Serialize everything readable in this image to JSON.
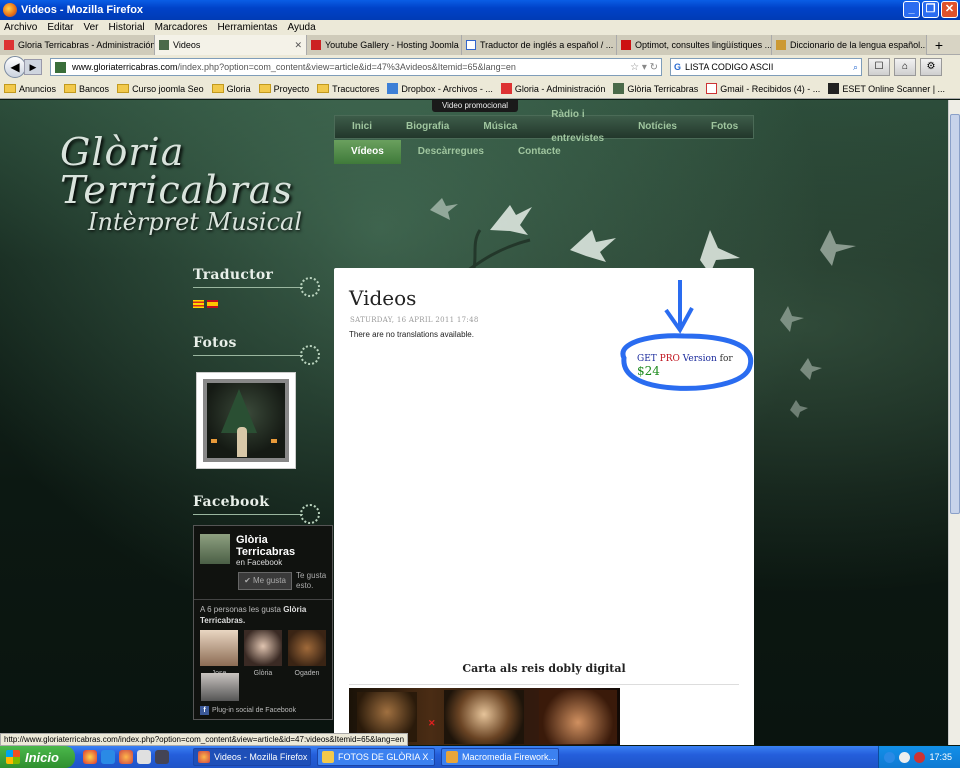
{
  "window": {
    "title": "Videos - Mozilla Firefox",
    "controls": [
      "_",
      "❐",
      "✕"
    ]
  },
  "menubar": [
    "Archivo",
    "Editar",
    "Ver",
    "Historial",
    "Marcadores",
    "Herramientas",
    "Ayuda"
  ],
  "tabs": [
    {
      "label": "Gloria Terricabras - Administración",
      "active": false
    },
    {
      "label": "Videos",
      "active": true
    },
    {
      "label": "Youtube Gallery - Hosting Joomla",
      "active": false
    },
    {
      "label": "Traductor de inglés a español / ...",
      "active": false
    },
    {
      "label": "Optimot, consultes lingüístiques ...",
      "active": false
    },
    {
      "label": "Diccionario de la lengua español...",
      "active": false
    }
  ],
  "navbar": {
    "url_domain": "www.gloriaterricabras.com",
    "url_rest": "/index.php?option=com_content&view=article&id=47%3Avideos&Itemid=65&lang=en",
    "search_value": "LISTA CODIGO ASCII",
    "search_engine": "G"
  },
  "bookmarks": [
    {
      "label": "Anuncios",
      "kind": "folder"
    },
    {
      "label": "Bancos",
      "kind": "folder"
    },
    {
      "label": "Curso joomla Seo",
      "kind": "folder"
    },
    {
      "label": "Gloria",
      "kind": "folder"
    },
    {
      "label": "Proyecto",
      "kind": "folder"
    },
    {
      "label": "Tracuctores",
      "kind": "folder"
    },
    {
      "label": "Dropbox - Archivos - ...",
      "kind": "site"
    },
    {
      "label": "Gloria - Administración",
      "kind": "site"
    },
    {
      "label": "Glòria Terricabras",
      "kind": "site"
    },
    {
      "label": "Gmail - Recibidos (4) - ...",
      "kind": "site"
    },
    {
      "label": "ESET Online Scanner | ...",
      "kind": "site"
    }
  ],
  "page": {
    "promo_label": "Video promocional",
    "logo": {
      "line1": "Glòria",
      "line2": "Terricabras",
      "line3": "Intèrpret Musical"
    },
    "nav_row1": [
      "Inici",
      "Biografia",
      "Música",
      "Ràdio i entrevistes",
      "Notícies",
      "Fotos"
    ],
    "nav_row2": [
      {
        "label": "Vídeos",
        "active": true
      },
      {
        "label": "Descàrregues",
        "active": false
      },
      {
        "label": "Contacte",
        "active": false
      }
    ],
    "sidebar": {
      "traductor": "Traductor",
      "fotos": "Fotos",
      "facebook": "Facebook"
    },
    "facebook": {
      "name": "Glòria Terricabras",
      "sub": "en Facebook",
      "like_button": "✔ Me gusta",
      "like_sub": "Te gusta esto.",
      "count_prefix": "A 6 personas les gusta",
      "count_name": "Glòria Terricabras.",
      "faces": [
        "Jose",
        "Glòria",
        "Ogaden"
      ],
      "plugin": "Plug-in social de Facebook"
    },
    "article": {
      "title": "Videos",
      "date": "SATURDAY, 16 APRIL 2011 17:48",
      "no_translations": "There are no translations available.",
      "pro": {
        "get": "GET",
        "pro": "PRO",
        "version": "Version",
        "for": "for",
        "price": "$24"
      },
      "video_title": "Carta als reis dobly digital"
    }
  },
  "statusbar": "http://www.gloriaterricabras.com/index.php?option=com_content&view=article&id=47:videos&Itemid=65&lang=en",
  "taskbar": {
    "start": "Inicio",
    "items": [
      {
        "label": "Videos - Mozilla Firefox",
        "active": true
      },
      {
        "label": "FOTOS DE GLÒRIA X ...",
        "active": false
      },
      {
        "label": "Macromedia Firework...",
        "active": false
      }
    ],
    "clock": "17:35"
  },
  "colors": {
    "annotation": "#2a6cf0",
    "nav_active": "#4f8c46",
    "price": "#1c8a1c"
  }
}
